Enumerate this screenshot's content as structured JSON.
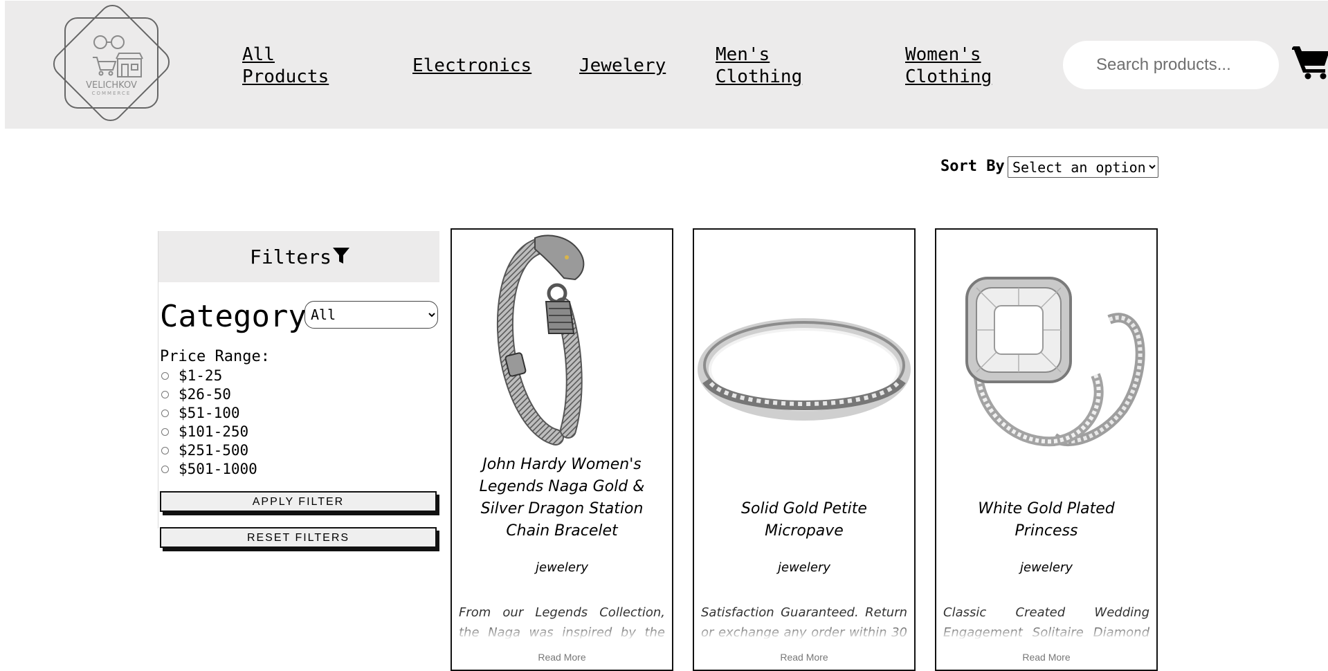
{
  "header": {
    "logo": {
      "icon": "store-logo-icon",
      "text": "VELICHKOV",
      "subtext": "COMMERCE"
    },
    "nav": [
      {
        "label_line1": "All",
        "label_line2": "Products"
      },
      {
        "label_line1": "Electronics",
        "label_line2": ""
      },
      {
        "label_line1": "Jewelery",
        "label_line2": ""
      },
      {
        "label_line1": "Men's",
        "label_line2": "Clothing"
      },
      {
        "label_line1": "Women's",
        "label_line2": "Clothing"
      }
    ],
    "search": {
      "placeholder": "Search products...",
      "value": ""
    },
    "cart_icon": "shopping-cart-icon"
  },
  "sort": {
    "label": "Sort By:",
    "selected": "Select an option"
  },
  "filters": {
    "title": "Filters",
    "icon": "funnel-icon",
    "category_label": "Category:",
    "category_selected": "All",
    "price_label": "Price Range:",
    "ranges": [
      "$1-25",
      "$26-50",
      "$51-100",
      "$101-250",
      "$251-500",
      "$501-1000"
    ],
    "apply_label": "APPLY FILTER",
    "reset_label": "RESET FILTERS"
  },
  "products": [
    {
      "title_lines": [
        "John Hardy Women's",
        "Legends Naga Gold &",
        "Silver Dragon Station",
        "Chain Bracelet"
      ],
      "category": "jewelery",
      "description": "From our Legends Collection, the Naga was inspired by the",
      "read_more": "Read More",
      "image": "dragon-bracelet-image"
    },
    {
      "title_lines": [
        "Solid Gold Petite",
        "Micropave"
      ],
      "category": "jewelery",
      "description": "Satisfaction Guaranteed. Return or exchange any order within 30",
      "read_more": "Read More",
      "image": "silver-band-ring-image"
    },
    {
      "title_lines": [
        "White Gold Plated",
        "Princess"
      ],
      "category": "jewelery",
      "description": "Classic Created Wedding Engagement Solitaire Diamond",
      "read_more": "Read More",
      "image": "princess-ring-image"
    }
  ]
}
